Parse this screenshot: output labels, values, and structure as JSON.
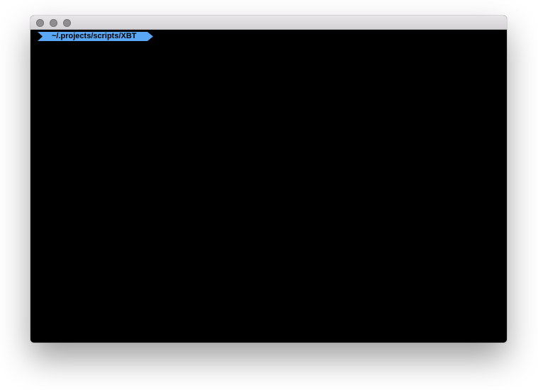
{
  "window": {
    "title": "",
    "traffic_lights": [
      {
        "name": "close-button",
        "color": "#8f8d8f"
      },
      {
        "name": "minimize-button",
        "color": "#8f8d8f"
      },
      {
        "name": "zoom-button",
        "color": "#8f8d8f"
      }
    ]
  },
  "terminal": {
    "background": "#000000",
    "prompt": {
      "path": "~/.projects/scripts/XBT",
      "segment_color": "#5aa8f5",
      "text_color": "#000000"
    }
  }
}
